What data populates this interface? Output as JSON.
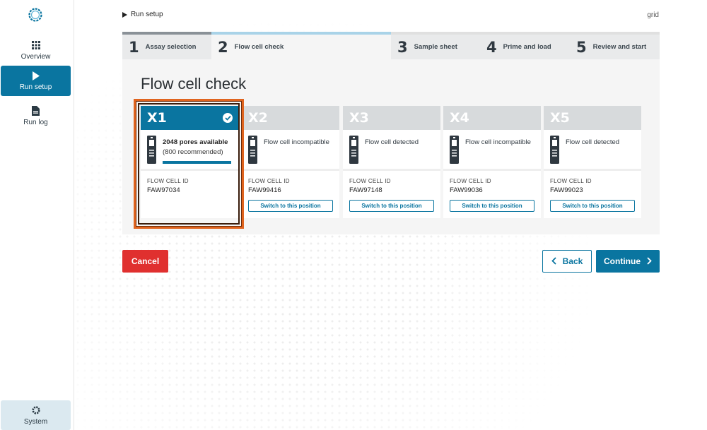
{
  "sidebar": {
    "items": [
      {
        "label": "Overview",
        "icon": "grid-icon"
      },
      {
        "label": "Run setup",
        "icon": "play-icon"
      },
      {
        "label": "Run log",
        "icon": "document-icon"
      }
    ],
    "system_label": "System"
  },
  "breadcrumb": {
    "label": "Run setup"
  },
  "grid_label": "grid",
  "stepper": [
    {
      "num": "1",
      "label": "Assay selection"
    },
    {
      "num": "2",
      "label": "Flow cell check"
    },
    {
      "num": "3",
      "label": "Sample sheet"
    },
    {
      "num": "4",
      "label": "Prime and load"
    },
    {
      "num": "5",
      "label": "Review and start"
    }
  ],
  "panel": {
    "title": "Flow cell check"
  },
  "cards": [
    {
      "position": "X1",
      "pores": "2048 pores available",
      "recommended": "(800 recommended)",
      "id_label": "FLOW CELL ID",
      "id": "FAW97034"
    },
    {
      "position": "X2",
      "status": "Flow cell incompatible",
      "id_label": "FLOW CELL ID",
      "id": "FAW99416",
      "button": "Switch to this position"
    },
    {
      "position": "X3",
      "status": "Flow cell detected",
      "id_label": "FLOW CELL ID",
      "id": "FAW97148",
      "button": "Switch to this position"
    },
    {
      "position": "X4",
      "status": "Flow cell incompatible",
      "id_label": "FLOW CELL ID",
      "id": "FAW99036",
      "button": "Switch to this position"
    },
    {
      "position": "X5",
      "status": "Flow cell detected",
      "id_label": "FLOW CELL ID",
      "id": "FAW99023",
      "button": "Switch to this position"
    }
  ],
  "buttons": {
    "cancel": "Cancel",
    "back": "Back",
    "continue": "Continue"
  },
  "colors": {
    "accent": "#0a75a0",
    "danger": "#e0302f",
    "highlight": "#e0641e"
  }
}
